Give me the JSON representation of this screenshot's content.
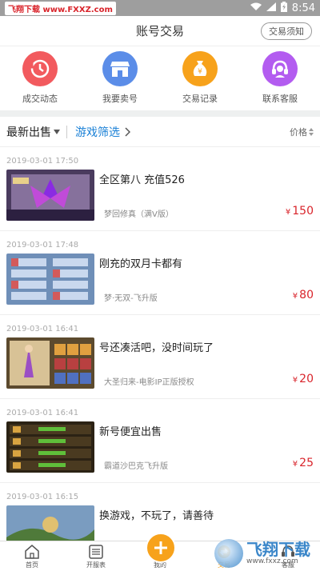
{
  "status_bar": {
    "watermark_text": "飞翔下载 www.FXXZ.com",
    "time": "8:54",
    "icons": [
      "wifi-icon",
      "signal-icon",
      "battery-icon"
    ]
  },
  "header": {
    "title": "账号交易",
    "notice_button": "交易须知"
  },
  "quick_menu": [
    {
      "label": "成交动态",
      "icon": "deal-icon",
      "color": "#f25a5e"
    },
    {
      "label": "我要卖号",
      "icon": "shop-icon",
      "color": "#5b8de8"
    },
    {
      "label": "交易记录",
      "icon": "money-bag-icon",
      "color": "#f7a21b"
    },
    {
      "label": "联系客服",
      "icon": "headset-icon",
      "color": "#b35cf0"
    }
  ],
  "filter": {
    "sort_label": "最新出售",
    "game_filter_label": "游戏筛选",
    "price_label": "价格"
  },
  "listings": [
    {
      "date": "2019-03-01 17:50",
      "title": "全区第八 充值526",
      "subtitle": "梦回修真（满V版）",
      "price": "150",
      "currency": "¥"
    },
    {
      "date": "2019-03-01 17:48",
      "title": "刚充的双月卡都有",
      "subtitle": "梦·无双-飞升版",
      "price": "80",
      "currency": "¥"
    },
    {
      "date": "2019-03-01 16:41",
      "title": "号还凑活吧，没时间玩了",
      "subtitle": "大圣归来-电影IP正版授权",
      "price": "20",
      "currency": "¥"
    },
    {
      "date": "2019-03-01 16:41",
      "title": "新号便宜出售",
      "subtitle": "霸道沙巴克飞升版",
      "price": "25",
      "currency": "¥"
    },
    {
      "date": "2019-03-01 16:15",
      "title": "换游戏，不玩了，请善待",
      "subtitle": "",
      "price": "",
      "currency": ""
    }
  ],
  "bottom_nav": [
    {
      "label": "首页",
      "icon": "home-icon",
      "active": false
    },
    {
      "label": "开服表",
      "icon": "list-icon",
      "active": false
    },
    {
      "label": "我的",
      "icon": "plus-icon",
      "active": false
    },
    {
      "label": "交易",
      "icon": "trade-icon",
      "active": true
    },
    {
      "label": "客服",
      "icon": "service-icon",
      "active": false
    }
  ],
  "watermark": {
    "name": "飞翔下载",
    "url": "www.fxxz.com"
  },
  "colors": {
    "accent_orange": "#f7a21b",
    "price_red": "#d9242b",
    "link_blue": "#1a80d6"
  }
}
